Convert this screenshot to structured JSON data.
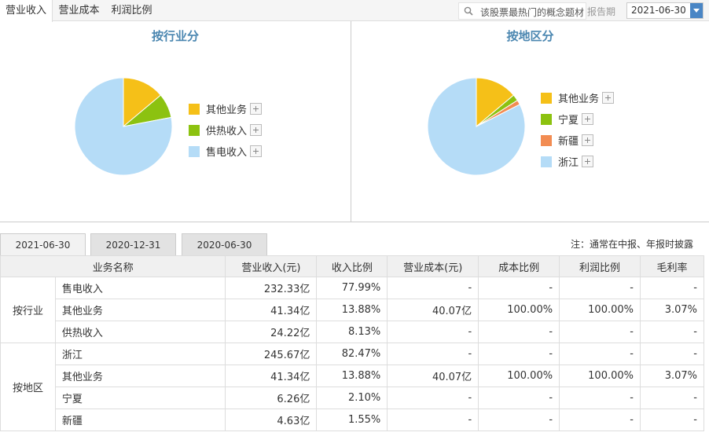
{
  "top_tabs": [
    "营业收入",
    "营业成本",
    "利润比例"
  ],
  "search": {
    "placeholder": "该股票最热门的概念题材"
  },
  "report_period": {
    "label": "报告期",
    "value": "2021-06-30"
  },
  "colors": {
    "other": "#f5c018",
    "heat": "#8cc210",
    "ningxia": "#8cc210",
    "xinjiang": "#f28c52",
    "blue": "#b5dcf7",
    "title": "#4a86b0"
  },
  "industry_panel": {
    "title": "按行业分",
    "legend": [
      "其他业务",
      "供热收入",
      "售电收入"
    ]
  },
  "region_panel": {
    "title": "按地区分",
    "legend": [
      "其他业务",
      "宁夏",
      "新疆",
      "浙江"
    ]
  },
  "period_tabs": [
    "2021-06-30",
    "2020-12-31",
    "2020-06-30"
  ],
  "note": "注：通常在中报、年报时披露",
  "table": {
    "headers": [
      "业务名称",
      "营业收入(元)",
      "收入比例",
      "营业成本(元)",
      "成本比例",
      "利润比例",
      "毛利率"
    ],
    "groups": [
      {
        "name": "按行业",
        "rows": [
          [
            "售电收入",
            "232.33亿",
            "77.99%",
            "-",
            "-",
            "-",
            "-"
          ],
          [
            "其他业务",
            "41.34亿",
            "13.88%",
            "40.07亿",
            "100.00%",
            "100.00%",
            "3.07%"
          ],
          [
            "供热收入",
            "24.22亿",
            "8.13%",
            "-",
            "-",
            "-",
            "-"
          ]
        ]
      },
      {
        "name": "按地区",
        "rows": [
          [
            "浙江",
            "245.67亿",
            "82.47%",
            "-",
            "-",
            "-",
            "-"
          ],
          [
            "其他业务",
            "41.34亿",
            "13.88%",
            "40.07亿",
            "100.00%",
            "100.00%",
            "3.07%"
          ],
          [
            "宁夏",
            "6.26亿",
            "2.10%",
            "-",
            "-",
            "-",
            "-"
          ],
          [
            "新疆",
            "4.63亿",
            "1.55%",
            "-",
            "-",
            "-",
            "-"
          ]
        ]
      }
    ]
  },
  "chart_data": [
    {
      "type": "pie",
      "title": "按行业分",
      "categories": [
        "其他业务",
        "供热收入",
        "售电收入"
      ],
      "values": [
        13.88,
        8.13,
        77.99
      ]
    },
    {
      "type": "pie",
      "title": "按地区分",
      "categories": [
        "其他业务",
        "宁夏",
        "新疆",
        "浙江"
      ],
      "values": [
        13.88,
        2.1,
        1.55,
        82.47
      ]
    }
  ]
}
